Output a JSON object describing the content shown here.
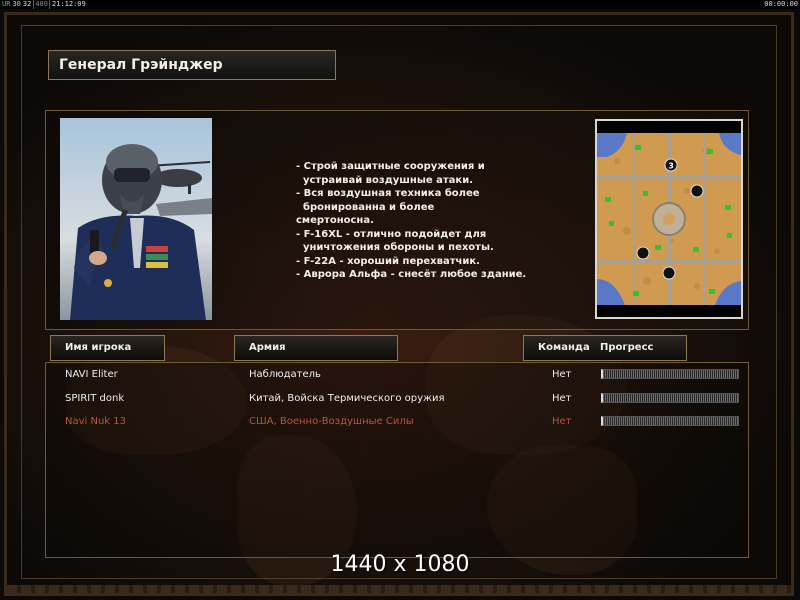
{
  "statusbar": {
    "indicators": [
      "UR",
      "30",
      "32",
      "480"
    ],
    "clock": "21:12:09",
    "timer": "00:00:00"
  },
  "general": {
    "title": "Генерал Грэйнджер",
    "description": [
      "- Строй защитные сооружения и",
      "  устраивай воздушные атаки.",
      "- Вся воздушная техника более",
      "  бронированна и более",
      "смертоносна.",
      "- F-16XL - отлично подойдет для",
      "  уничтожения обороны и пехоты.",
      "- F-22A - хороший перехватчик.",
      "- Аврора Альфа - снесёт любое здание."
    ]
  },
  "minimap": {
    "markers": [
      "3",
      "",
      "",
      ""
    ]
  },
  "table": {
    "headers": {
      "player": "Имя игрока",
      "army": "Армия",
      "team": "Команда",
      "progress": "Прогресс"
    },
    "rows": [
      {
        "name": "NAVI Eliter",
        "army": "Наблюдатель",
        "team": "Нет",
        "progress": 0,
        "active": true
      },
      {
        "name": "SPIRIT donk",
        "army": "Китай, Войска Термического оружия",
        "team": "Нет",
        "progress": 0,
        "active": true
      },
      {
        "name": "Navi Nuk 13",
        "army": "США, Военно-Воздушные Силы",
        "team": "Нет",
        "progress": 0,
        "active": false
      }
    ]
  },
  "overlay": {
    "resolution": "1440 x 1080"
  },
  "colors": {
    "accent_border": "#8a7a5a",
    "inactive_player": "#b8563c",
    "terrain": "#d09a50"
  }
}
